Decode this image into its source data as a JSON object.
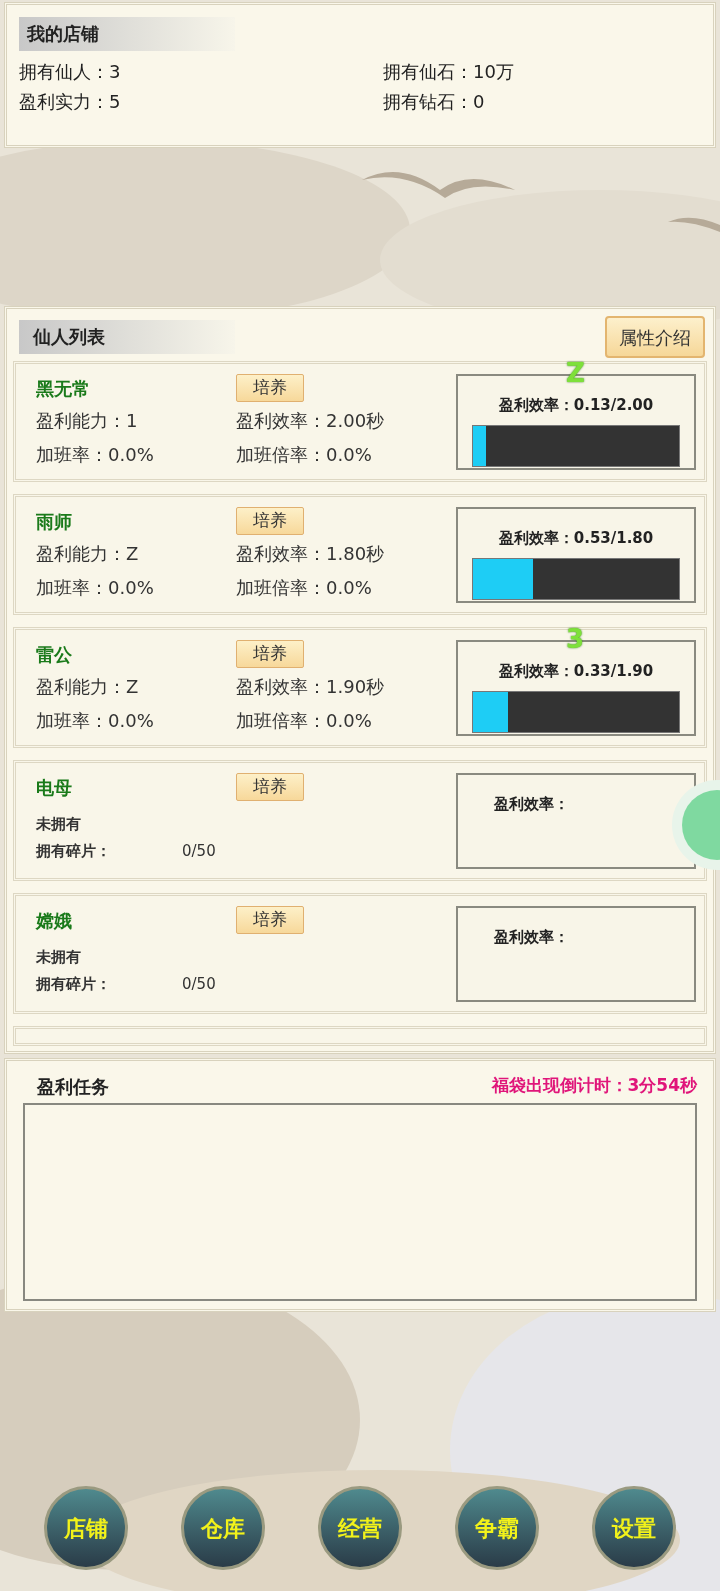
{
  "shop": {
    "title": "我的店铺",
    "stats": [
      {
        "label": "拥有仙人：",
        "value": "3"
      },
      {
        "label": "拥有仙石：",
        "value": "10万"
      },
      {
        "label": "盈利实力：",
        "value": "5"
      },
      {
        "label": "拥有钻石：",
        "value": "0"
      }
    ]
  },
  "immortals": {
    "title": "仙人列表",
    "info_button": "属性介绍",
    "items": [
      {
        "kind": "owned",
        "name": "黑无常",
        "train_button": "培养",
        "stats": [
          "盈利能力：1",
          "盈利效率：2.00秒",
          "加班率：0.0%",
          "加班倍率：0.0%"
        ],
        "meter_label": "盈利效率：0.13/2.00",
        "level": 0.065,
        "popup": "Z"
      },
      {
        "kind": "owned",
        "name": "雨师",
        "train_button": "培养",
        "stats": [
          "盈利能力：Z",
          "盈利效率：1.80秒",
          "加班率：0.0%",
          "加班倍率：0.0%"
        ],
        "meter_label": "盈利效率：0.53/1.80",
        "level": 0.29
      },
      {
        "kind": "owned",
        "name": "雷公",
        "train_button": "培养",
        "stats": [
          "盈利能力：Z",
          "盈利效率：1.90秒",
          "加班率：0.0%",
          "加班倍率：0.0%"
        ],
        "meter_label": "盈利效率：0.33/1.90",
        "level": 0.17,
        "popup": "3"
      },
      {
        "kind": "unowned",
        "name": "电母",
        "train_button": "培养",
        "status": "未拥有",
        "shards_label": "拥有碎片：",
        "shards": "0/50",
        "meter_label": "盈利效率："
      },
      {
        "kind": "unowned",
        "name": "嫦娥",
        "train_button": "培养",
        "status": "未拥有",
        "shards_label": "拥有碎片：",
        "shards": "0/50",
        "meter_label": "盈利效率："
      }
    ]
  },
  "tasks": {
    "title": "盈利任务",
    "countdown": "福袋出现倒计时：3分54秒"
  },
  "nav": [
    "店铺",
    "仓库",
    "经营",
    "争霸",
    "设置"
  ]
}
